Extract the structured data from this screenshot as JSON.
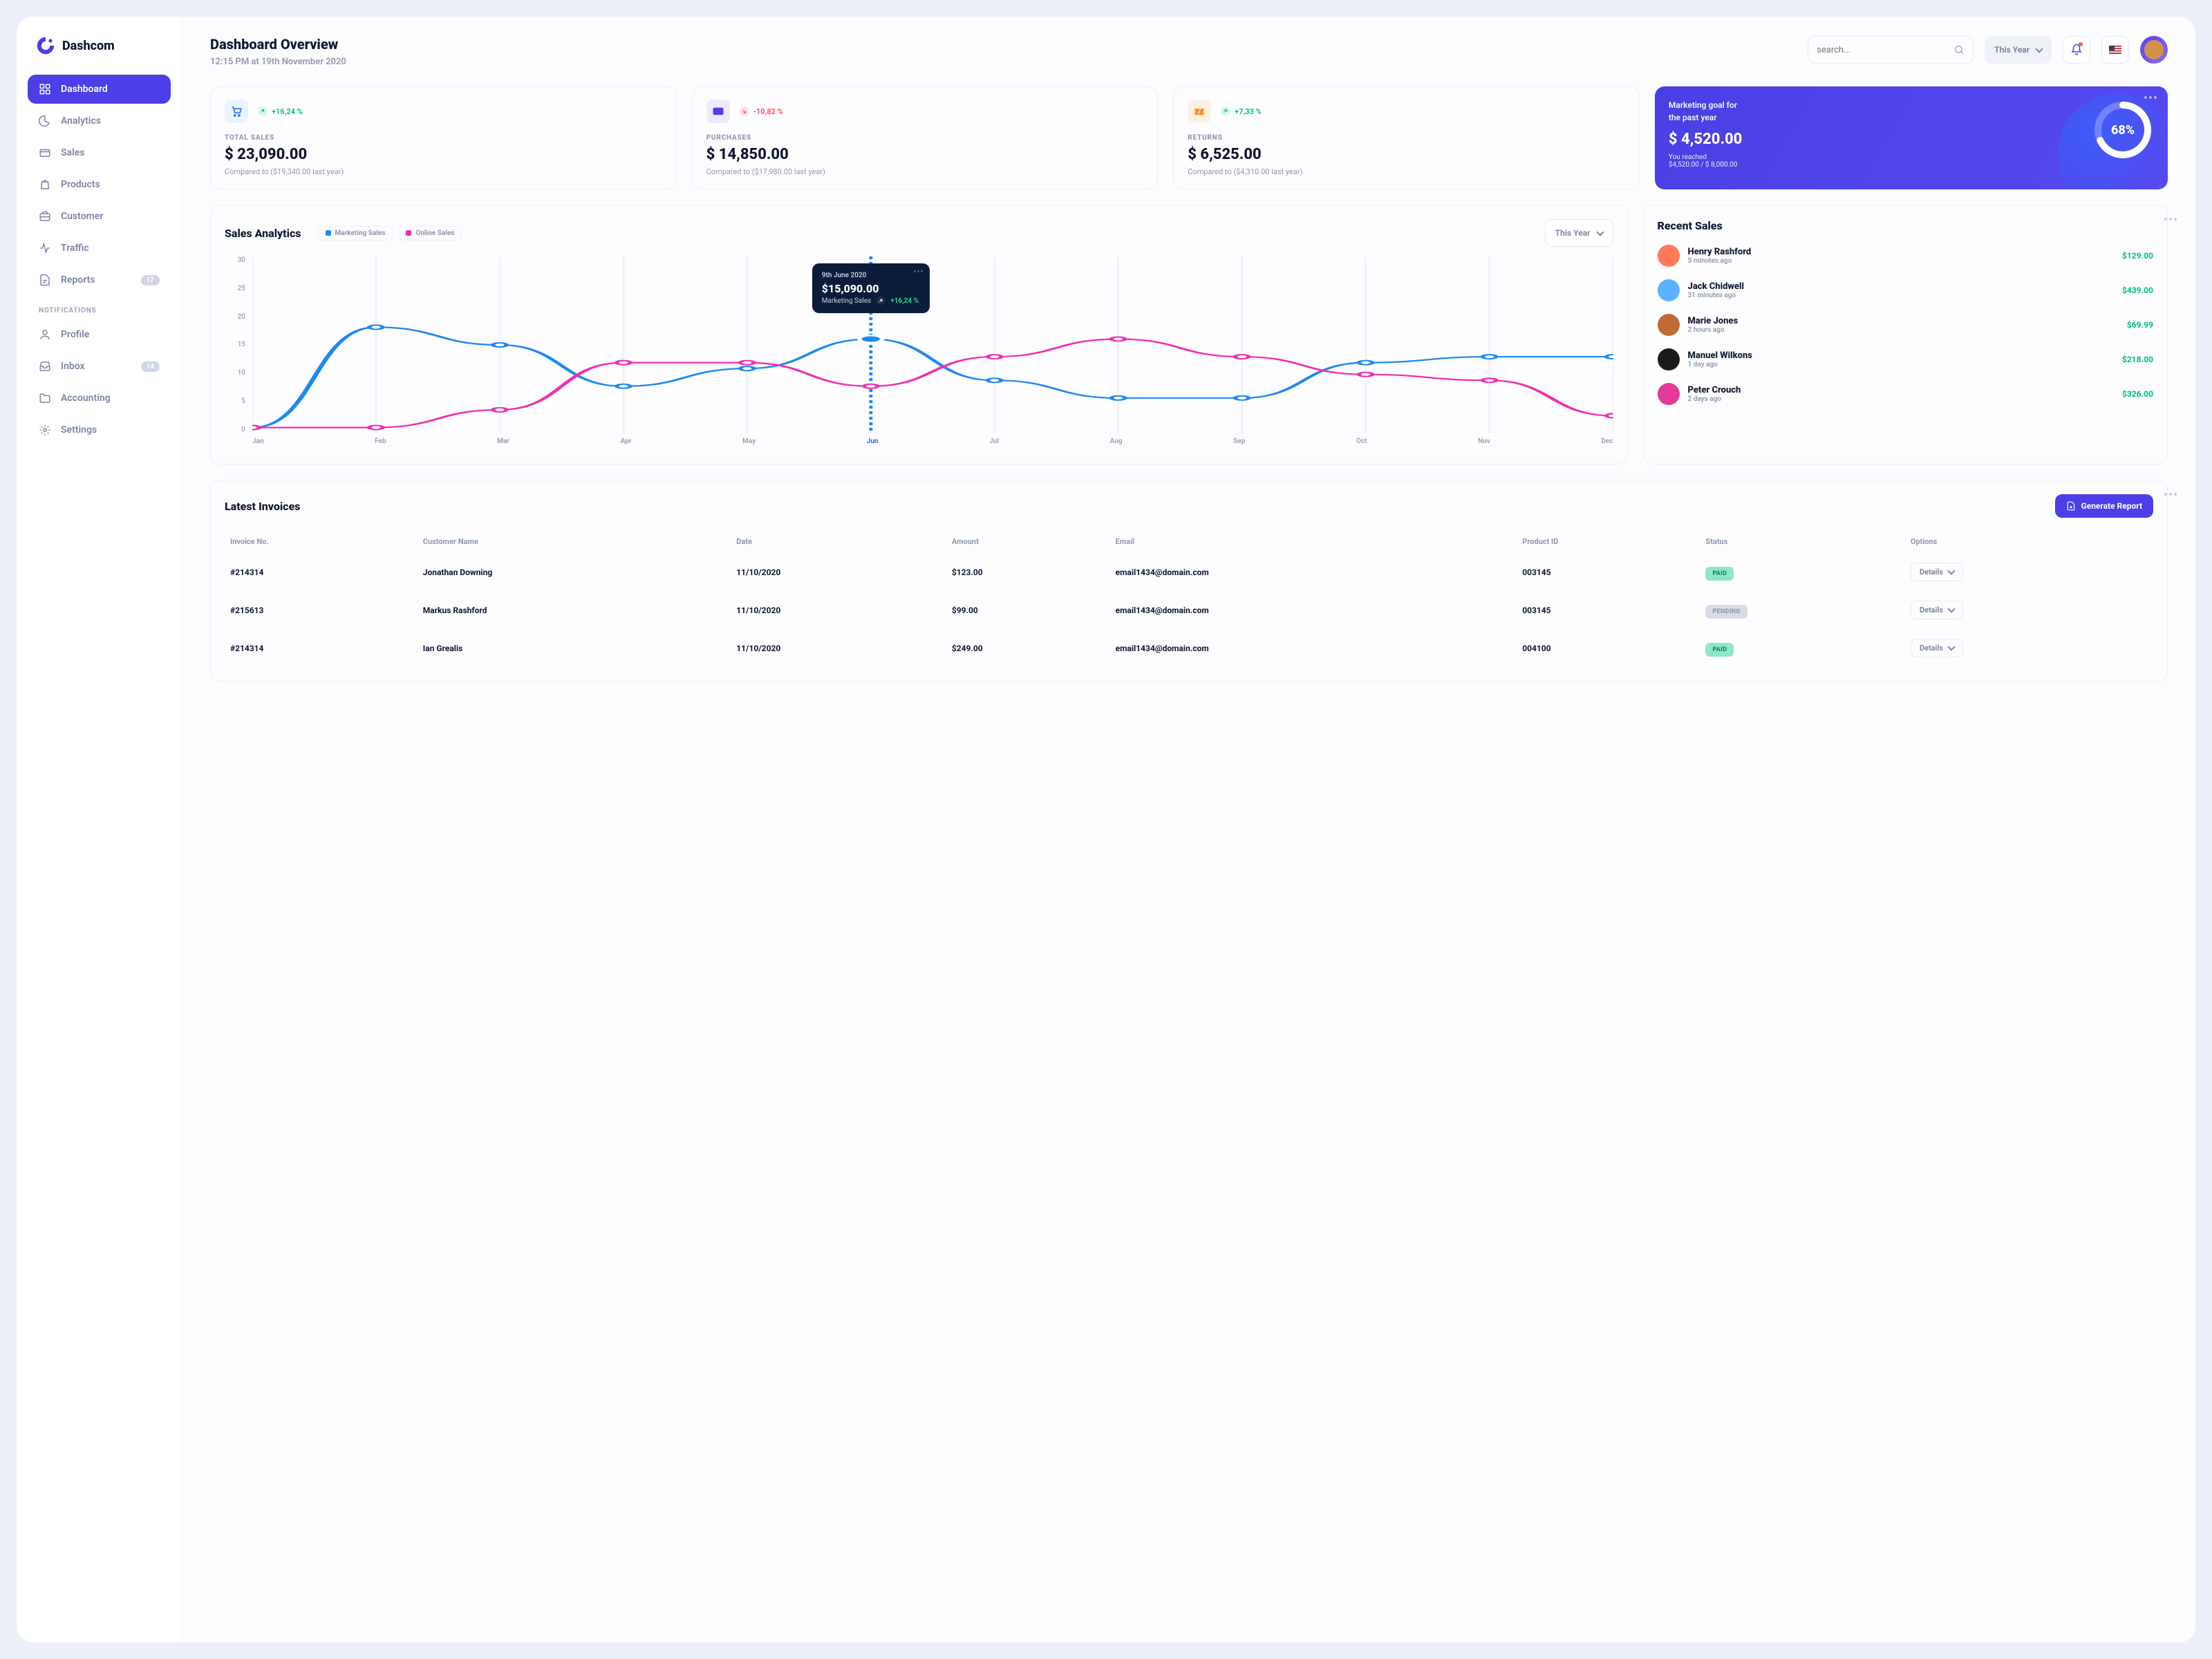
{
  "brand": "Dashcom",
  "header": {
    "title": "Dashboard Overview",
    "subtitle": "12:15 PM at 19th November 2020",
    "search_placeholder": "search...",
    "period_label": "This Year"
  },
  "sidebar": {
    "items": [
      {
        "label": "Dashboard",
        "icon": "grid",
        "active": true
      },
      {
        "label": "Analytics",
        "icon": "pie"
      },
      {
        "label": "Sales",
        "icon": "wallet"
      },
      {
        "label": "Products",
        "icon": "bag"
      },
      {
        "label": "Customer",
        "icon": "briefcase"
      },
      {
        "label": "Traffic",
        "icon": "activity"
      },
      {
        "label": "Reports",
        "icon": "file",
        "badge": "17"
      }
    ],
    "section_label": "NOTIFICATIONS",
    "items2": [
      {
        "label": "Profile",
        "icon": "user"
      },
      {
        "label": "Inbox",
        "icon": "inbox",
        "badge": "14"
      },
      {
        "label": "Accounting",
        "icon": "folder"
      },
      {
        "label": "Settings",
        "icon": "gear"
      }
    ]
  },
  "stats": [
    {
      "icon": "cart",
      "icon_bg": "#e9f4ff",
      "icon_fg": "#1d6ef0",
      "delta": "+16,24 %",
      "dir": "up",
      "label": "TOTAL SALES",
      "value": "$ 23,090.00",
      "compare": "Compared to ($19,340.00 last year)"
    },
    {
      "icon": "card",
      "icon_bg": "#eceaff",
      "icon_fg": "#4c3fe7",
      "delta": "-10,82 %",
      "dir": "down",
      "label": "PURCHASES",
      "value": "$ 14,850.00",
      "compare": "Compared to ($17,980.00 last year)"
    },
    {
      "icon": "ticket",
      "icon_bg": "#fff1e2",
      "icon_fg": "#ff8a1e",
      "delta": "+7,33 %",
      "dir": "up",
      "label": "RETURNS",
      "value": "$ 6,525.00",
      "compare": "Compared to ($4,310.00 last year)"
    }
  ],
  "goal": {
    "title_l1": "Marketing goal for",
    "title_l2": "the past year",
    "value": "$ 4,520.00",
    "reached_label": "You reached",
    "reached_detail": "$4,520.00 / $ 8,000.00",
    "percent_label": "68%",
    "percent": 68
  },
  "analytics": {
    "title": "Sales Analytics",
    "legend": [
      {
        "label": "Marketing Sales",
        "color": "#1d8af0"
      },
      {
        "label": "Online Sales",
        "color": "#ef2fb2"
      }
    ],
    "period_label": "This Year",
    "tooltip": {
      "date": "9th June 2020",
      "value": "$15,090.00",
      "series": "Marketing Sales",
      "delta": "+16,24 %"
    }
  },
  "chart_data": {
    "type": "line",
    "xlabel": "",
    "ylabel": "",
    "ylim": [
      0,
      30
    ],
    "yticks": [
      0,
      5,
      10,
      15,
      20,
      25,
      30
    ],
    "categories": [
      "Jan",
      "Feb",
      "Mar",
      "Apr",
      "May",
      "Jun",
      "Jul",
      "Aug",
      "Sep",
      "Oct",
      "Nov",
      "Dec"
    ],
    "highlight_index": 5,
    "series": [
      {
        "name": "Marketing Sales",
        "color": "#1d8af0",
        "values": [
          1,
          18,
          15,
          8,
          11,
          16,
          9,
          6,
          6,
          12,
          13,
          13
        ]
      },
      {
        "name": "Online Sales",
        "color": "#ef2fb2",
        "values": [
          1,
          1,
          4,
          12,
          12,
          8,
          13,
          16,
          13,
          10,
          9,
          3
        ]
      }
    ]
  },
  "recent_sales": {
    "title": "Recent Sales",
    "items": [
      {
        "name": "Henry Rashford",
        "time": "5 minutes ago",
        "amount": "$129.00",
        "avc": "#ff7a59"
      },
      {
        "name": "Jack Chidwell",
        "time": "31 minutes ago",
        "amount": "$439.00",
        "avc": "#5bb0ff"
      },
      {
        "name": "Marie Jones",
        "time": "2 hours ago",
        "amount": "$69.99",
        "avc": "#c06b35"
      },
      {
        "name": "Manuel Wilkons",
        "time": "1 day ago",
        "amount": "$218.00",
        "avc": "#1a1a1a"
      },
      {
        "name": "Peter Crouch",
        "time": "2 days ago",
        "amount": "$326.00",
        "avc": "#e23b9b"
      }
    ]
  },
  "invoices": {
    "title": "Latest Invoices",
    "generate_label": "Generate Report",
    "columns": [
      "Invoice No.",
      "Customer Name",
      "Date",
      "Amount",
      "Email",
      "Product ID",
      "Status",
      "Options"
    ],
    "option_label": "Details",
    "rows": [
      {
        "no": "#214314",
        "name": "Jonathan Downing",
        "date": "11/10/2020",
        "amount": "$123.00",
        "email": "email1434@domain.com",
        "pid": "003145",
        "status": "PAID",
        "status_kind": "paid"
      },
      {
        "no": "#215613",
        "name": "Markus Rashford",
        "date": "11/10/2020",
        "amount": "$99.00",
        "email": "email1434@domain.com",
        "pid": "003145",
        "status": "PENDING",
        "status_kind": "pending"
      },
      {
        "no": "#214314",
        "name": "Ian Grealis",
        "date": "11/10/2020",
        "amount": "$249.00",
        "email": "email1434@domain.com",
        "pid": "004100",
        "status": "PAID",
        "status_kind": "paid"
      }
    ]
  },
  "colors": {
    "primary": "#4c3fe7",
    "accent_up": "#0bbf8a",
    "accent_down": "#ff4d5e"
  }
}
